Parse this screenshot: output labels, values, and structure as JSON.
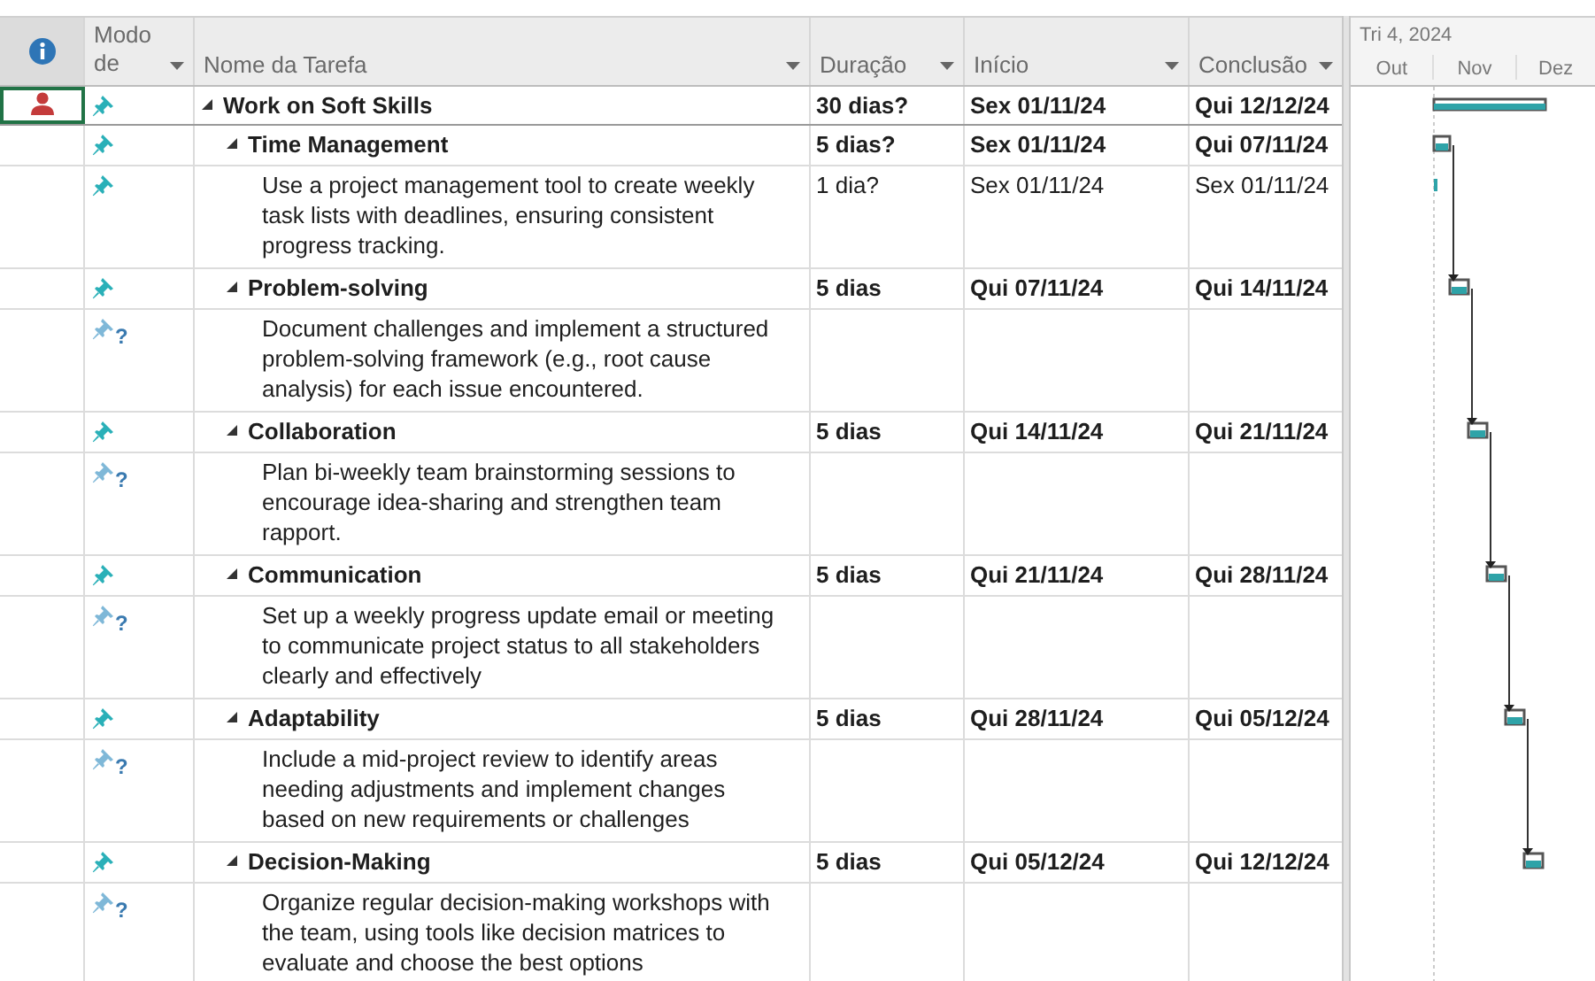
{
  "columns": [
    {
      "label": "Modo de"
    },
    {
      "label": "Nome da Tarefa"
    },
    {
      "label": "Duração"
    },
    {
      "label": "Início"
    },
    {
      "label": "Conclusão"
    }
  ],
  "timescale": {
    "period": "Tri 4, 2024",
    "months": [
      "Out",
      "Nov",
      "Dez"
    ]
  },
  "tasks": [
    {
      "name": "Work on Soft Skills",
      "duration": "30 dias?",
      "start": "Sex 01/11/24",
      "finish": "Qui 12/12/24",
      "manual": false,
      "resource_assigned": true,
      "selected": true,
      "expanded": true,
      "children": [
        {
          "name": "Time Management",
          "duration": "5 dias?",
          "start": "Sex 01/11/24",
          "finish": "Qui 07/11/24",
          "manual": false,
          "resource_assigned": false,
          "selected": false,
          "expanded": true,
          "children": [
            {
              "name": "Use a project management tool to create weekly task lists with deadlines, ensuring consistent progress tracking.",
              "duration": "1 dia?",
              "start": "Sex 01/11/24",
              "finish": "Sex 01/11/24",
              "manual": false,
              "resource_assigned": false,
              "selected": false
            }
          ]
        },
        {
          "name": "Problem-solving",
          "duration": "5 dias",
          "start": "Qui 07/11/24",
          "finish": "Qui 14/11/24",
          "manual": false,
          "resource_assigned": false,
          "selected": false,
          "expanded": true,
          "children": [
            {
              "name": "Document challenges and implement a structured problem-solving framework (e.g., root cause analysis) for each issue encountered.",
              "manual": true,
              "mode_mark": "?",
              "resource_assigned": false,
              "selected": false
            }
          ]
        },
        {
          "name": "Collaboration",
          "duration": "5 dias",
          "start": "Qui 14/11/24",
          "finish": "Qui 21/11/24",
          "manual": false,
          "resource_assigned": false,
          "selected": false,
          "expanded": true,
          "children": [
            {
              "name": "Plan bi-weekly team brainstorming sessions to encourage idea-sharing and strengthen team rapport.",
              "manual": true,
              "mode_mark": "?",
              "resource_assigned": false,
              "selected": false
            }
          ]
        },
        {
          "name": "Communication",
          "duration": "5 dias",
          "start": "Qui 21/11/24",
          "finish": "Qui 28/11/24",
          "manual": false,
          "resource_assigned": false,
          "selected": false,
          "expanded": true,
          "children": [
            {
              "name": "Set up a weekly progress update email or meeting to communicate project status to all stakeholders clearly and effectively",
              "manual": true,
              "mode_mark": "?",
              "resource_assigned": false,
              "selected": false
            }
          ]
        },
        {
          "name": "Adaptability",
          "duration": "5 dias",
          "start": "Qui 28/11/24",
          "finish": "Qui 05/12/24",
          "manual": false,
          "resource_assigned": false,
          "selected": false,
          "expanded": true,
          "children": [
            {
              "name": "Include a mid-project review to identify areas needing adjustments and implement changes based on new requirements or challenges",
              "manual": true,
              "mode_mark": "?",
              "resource_assigned": false,
              "selected": false
            }
          ]
        },
        {
          "name": "Decision-Making",
          "duration": "5 dias",
          "start": "Qui 05/12/24",
          "finish": "Qui 12/12/24",
          "manual": false,
          "resource_assigned": false,
          "selected": false,
          "expanded": true,
          "children": [
            {
              "name": "Organize regular decision-making workshops with the team, using tools like decision matrices to evaluate and choose the best options",
              "manual": true,
              "mode_mark": "?",
              "resource_assigned": false,
              "selected": false
            }
          ]
        }
      ]
    }
  ]
}
